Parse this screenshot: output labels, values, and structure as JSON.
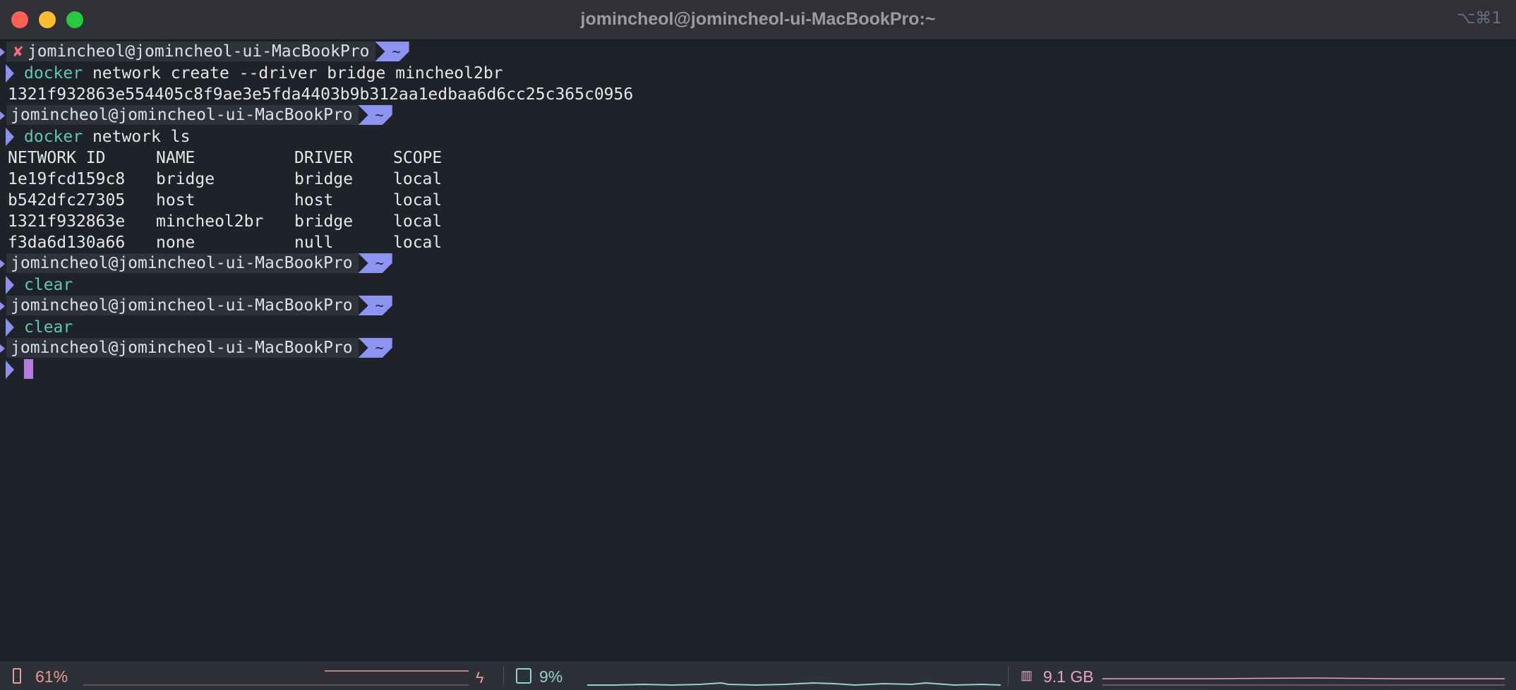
{
  "window": {
    "title": "jomincheol@jomincheol-ui-MacBookPro:~",
    "shortcut": "⌥⌘1"
  },
  "prompt": {
    "user_host": "jomincheol@jomincheol-ui-MacBookPro",
    "dir": "~",
    "error_mark": "✘"
  },
  "commands": {
    "cmd1_name": "docker",
    "cmd1_args": "network create --driver bridge mincheol2br",
    "cmd1_output": "1321f932863e554405c8f9ae3e5fda4403b9b312aa1edbaa6d6cc25c365c0956",
    "cmd2_name": "docker",
    "cmd2_args": "network ls",
    "cmd3_name": "clear",
    "cmd4_name": "clear"
  },
  "network_table": {
    "headers": [
      "NETWORK ID",
      "NAME",
      "DRIVER",
      "SCOPE"
    ],
    "rows": [
      [
        "1e19fcd159c8",
        "bridge",
        "bridge",
        "local"
      ],
      [
        "b542dfc27305",
        "host",
        "host",
        "local"
      ],
      [
        "1321f932863e",
        "mincheol2br",
        "bridge",
        "local"
      ],
      [
        "f3da6d130a66",
        "none",
        "null",
        "local"
      ]
    ]
  },
  "statusbar": {
    "battery": "61%",
    "cpu": "9%",
    "memory": "9.1 GB",
    "battery_color": "#e59a9a",
    "cpu_color": "#8fd6c4",
    "memory_color": "#e4a3cf"
  },
  "colors": {
    "background": "#1f2228",
    "prompt_accent": "#8c94f2",
    "command": "#5fc9b4",
    "cursor": "#b77be0",
    "error": "#ff6a7a"
  }
}
